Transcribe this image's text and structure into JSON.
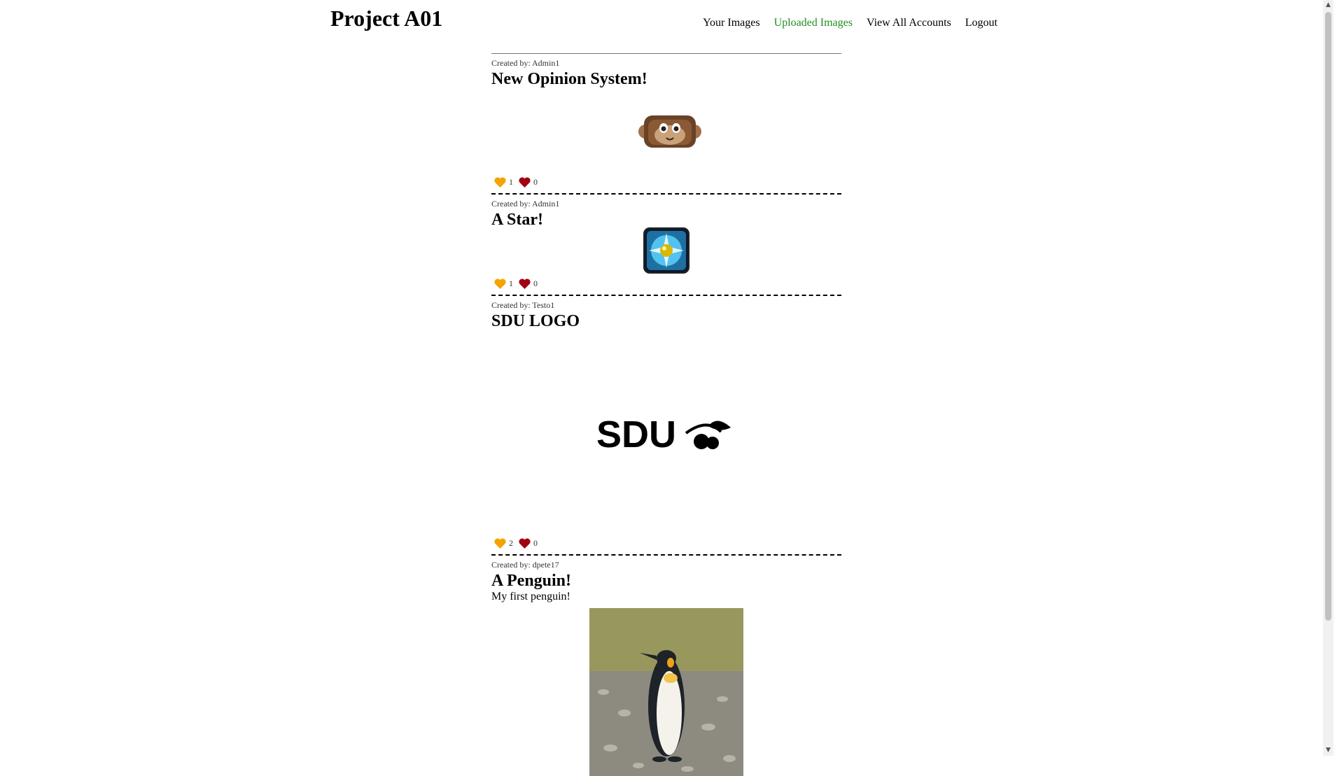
{
  "header": {
    "title": "Project A01",
    "nav": [
      {
        "label": "Your Images",
        "active": false
      },
      {
        "label": "Uploaded Images",
        "active": true
      },
      {
        "label": "View All Accounts",
        "active": false
      },
      {
        "label": "Logout",
        "active": false
      }
    ]
  },
  "colors": {
    "accent": "#1f8f1f",
    "like": "#f5a300",
    "dislike": "#a00010"
  },
  "posts": [
    {
      "created_by": "Created by: Admin1",
      "title": "New Opinion System!",
      "description": "",
      "image": "monkey-avatar",
      "likes": "1",
      "dislikes": "0"
    },
    {
      "created_by": "Created by: Admin1",
      "title": "A Star!",
      "description": "",
      "image": "star-gem-icon",
      "likes": "1",
      "dislikes": "0"
    },
    {
      "created_by": "Created by: Testo1",
      "title": "SDU LOGO",
      "description": "",
      "image": "sdu-logo",
      "logo_text": "SDU",
      "likes": "2",
      "dislikes": "0"
    },
    {
      "created_by": "Created by: dpete17",
      "title": "A Penguin!",
      "description": "My first penguin!",
      "image": "penguin-photo"
    }
  ]
}
